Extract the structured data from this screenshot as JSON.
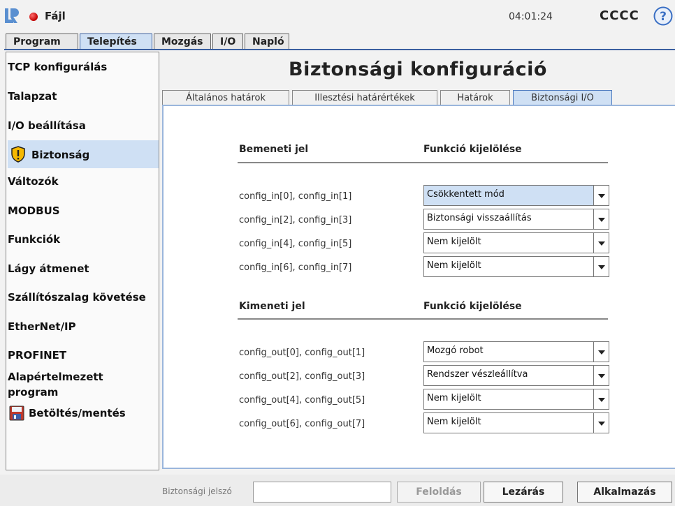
{
  "titlebar": {
    "menu_label": "Fájl",
    "clock": "04:01:24",
    "robot_name": "CCCC"
  },
  "main_tabs": [
    "Program",
    "Telepítés",
    "Mozgás",
    "I/O",
    "Napló"
  ],
  "sidebar": {
    "items": [
      {
        "label": "TCP konfigurálás"
      },
      {
        "label": "Talapzat"
      },
      {
        "label": "I/O beállítása"
      },
      {
        "label": "Biztonság"
      },
      {
        "label": "Változók"
      },
      {
        "label": "MODBUS"
      },
      {
        "label": "Funkciók"
      },
      {
        "label": "Lágy átmenet"
      },
      {
        "label": "Szállítószalag követése"
      },
      {
        "label": "EtherNet/IP"
      },
      {
        "label": "PROFINET"
      },
      {
        "label": "Alapértelmezett program"
      },
      {
        "label": "Betöltés/mentés"
      }
    ]
  },
  "content": {
    "title": "Biztonsági konfiguráció",
    "sub_tabs": [
      "Általános határok",
      "Illesztési határértékek",
      "Határok",
      "Biztonsági I/O"
    ],
    "inputs": {
      "header_signal": "Bemeneti jel",
      "header_function": "Funkció kijelölése",
      "rows": [
        {
          "signal": "config_in[0], config_in[1]",
          "function": "Csökkentett mód"
        },
        {
          "signal": "config_in[2], config_in[3]",
          "function": "Biztonsági visszaállítás"
        },
        {
          "signal": "config_in[4], config_in[5]",
          "function": "Nem kijelölt"
        },
        {
          "signal": "config_in[6], config_in[7]",
          "function": "Nem kijelölt"
        }
      ]
    },
    "outputs": {
      "header_signal": "Kimeneti jel",
      "header_function": "Funkció kijelölése",
      "rows": [
        {
          "signal": "config_out[0], config_out[1]",
          "function": "Mozgó robot"
        },
        {
          "signal": "config_out[2], config_out[3]",
          "function": "Rendszer vészleállítva"
        },
        {
          "signal": "config_out[4], config_out[5]",
          "function": "Nem kijelölt"
        },
        {
          "signal": "config_out[6], config_out[7]",
          "function": "Nem kijelölt"
        }
      ]
    }
  },
  "bottom": {
    "password_label": "Biztonsági jelszó",
    "password_value": "",
    "unlock_label": "Feloldás",
    "lock_label": "Lezárás",
    "apply_label": "Alkalmazás"
  },
  "colors": {
    "accent": "#3a5fa0",
    "selection": "#cfe0f4",
    "warning_icon": "#f5b800"
  }
}
